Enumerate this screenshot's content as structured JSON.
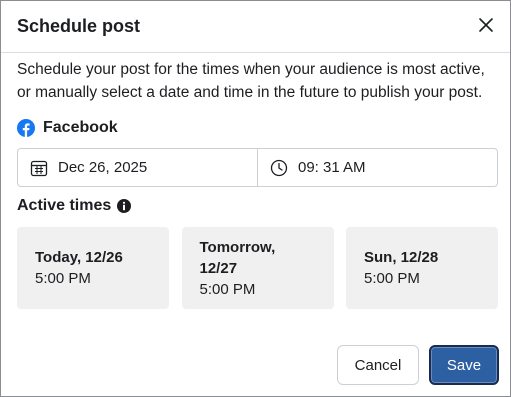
{
  "dialog": {
    "title": "Schedule post",
    "description": "Schedule your post for the times when your audience is most active, or manually select a date and time in the future to publish your post."
  },
  "platform": {
    "label": "Facebook",
    "icon": "facebook-icon",
    "color": "#1877f2"
  },
  "date_field": {
    "value": "Dec 26, 2025",
    "icon": "calendar-icon"
  },
  "time_field": {
    "value": "09: 31 AM",
    "icon": "clock-icon"
  },
  "active_times": {
    "label": "Active times",
    "info_icon": "info-icon",
    "slots": [
      {
        "day": "Today, 12/26",
        "time": "5:00 PM"
      },
      {
        "day": "Tomorrow, 12/27",
        "time": "5:00 PM"
      },
      {
        "day": "Sun, 12/28",
        "time": "5:00 PM"
      }
    ]
  },
  "buttons": {
    "cancel_label": "Cancel",
    "save_label": "Save",
    "save_color": "#2d5fa3"
  }
}
